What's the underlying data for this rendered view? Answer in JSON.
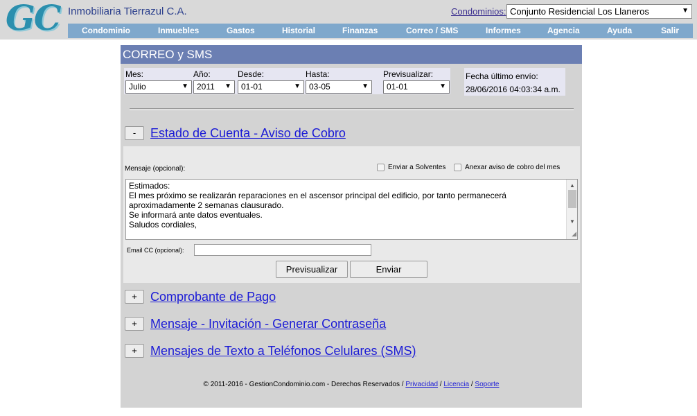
{
  "header": {
    "logo": "GC",
    "company": "Inmobiliaria Tierrazul C.A.",
    "condo_label": "Condominios:",
    "condo_selected": "Conjunto Residencial Los Llaneros"
  },
  "nav": [
    "Condominio",
    "Inmuebles",
    "Gastos",
    "Historial",
    "Finanzas",
    "Correo / SMS",
    "Informes",
    "Agencia",
    "Ayuda",
    "Salir"
  ],
  "panel": {
    "title": "CORREO y SMS",
    "filters": {
      "mes_label": "Mes:",
      "mes_value": "Julio",
      "anio_label": "Año:",
      "anio_value": "2011",
      "desde_label": "Desde:",
      "desde_value": "01-01",
      "hasta_label": "Hasta:",
      "hasta_value": "03-05",
      "previsualizar_label": "Previsualizar:",
      "previsualizar_value": "01-01"
    },
    "last_sent_label": "Fecha último envío:",
    "last_sent_value": "28/06/2016 04:03:34 a.m."
  },
  "sections": [
    {
      "toggle": "-",
      "title": "Estado de Cuenta - Aviso de Cobro"
    },
    {
      "toggle": "+",
      "title": "Comprobante de Pago"
    },
    {
      "toggle": "+",
      "title": "Mensaje - Invitación - Generar Contraseña"
    },
    {
      "toggle": "+",
      "title": "Mensajes de Texto a Teléfonos Celulares (SMS)"
    }
  ],
  "message": {
    "label": "Mensaje (opcional):",
    "chk_solventes": "Enviar a Solventes",
    "chk_anexar": "Anexar aviso de cobro del mes",
    "lines": [
      "Estimados:",
      "El mes próximo se realizarán reparaciones en el ascensor principal del edificio, por tanto permanecerá",
      "aproximadamente 2 semanas clausurado.",
      "Se informará ante datos eventuales.",
      "Saludos cordiales,"
    ],
    "cc_label": "Email CC (opcional):",
    "cc_value": "",
    "btn_preview": "Previsualizar",
    "btn_send": "Enviar"
  },
  "footer": {
    "text": "© 2011-2016 - GestionCondominio.com - Derechos Reservados /",
    "links": [
      "Privacidad",
      "Licencia",
      "Soporte"
    ]
  }
}
